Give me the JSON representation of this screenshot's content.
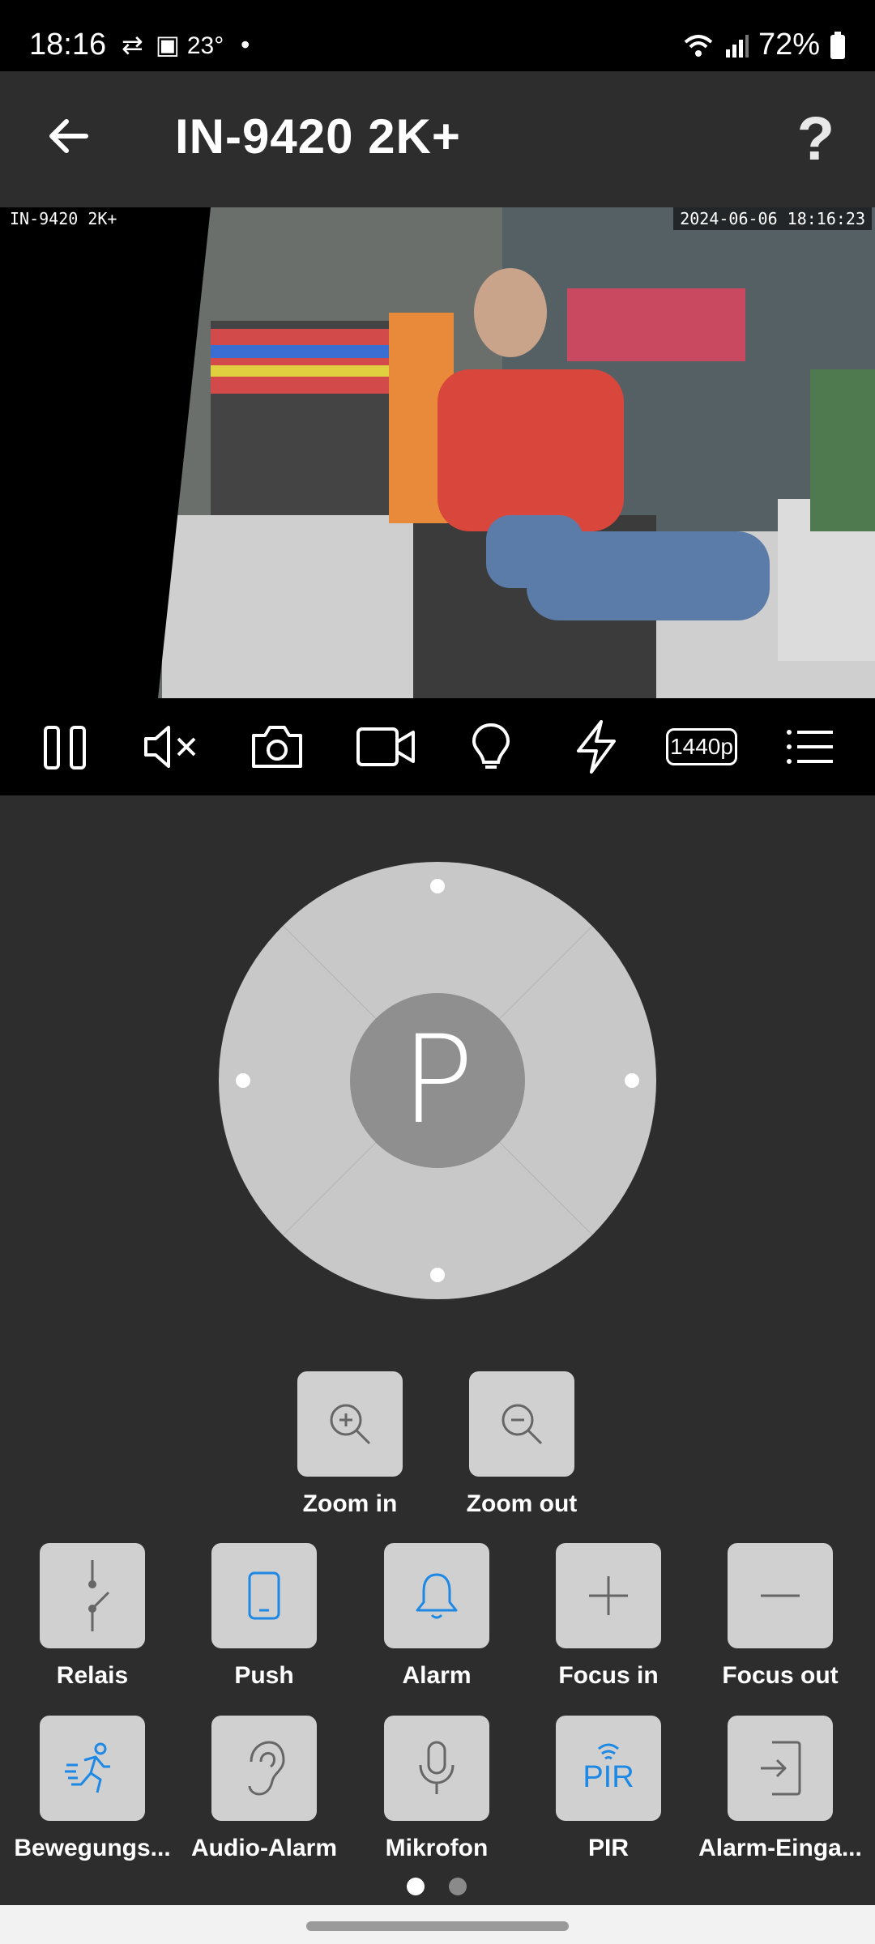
{
  "status_bar": {
    "time": "18:16",
    "temperature": "23°",
    "battery": "72%"
  },
  "header": {
    "title": "IN-9420  2K+",
    "help": "?"
  },
  "video": {
    "overlay_left": "IN-9420 2K+",
    "overlay_right": "2024-06-06 18:16:23"
  },
  "toolbar": {
    "resolution": "1440p"
  },
  "ptz": {
    "center": "P"
  },
  "zoom": {
    "in_label": "Zoom in",
    "out_label": "Zoom out"
  },
  "row1": [
    {
      "label": "Relais",
      "icon": "relay-switch-icon"
    },
    {
      "label": "Push",
      "icon": "phone-icon"
    },
    {
      "label": "Alarm",
      "icon": "bell-icon"
    },
    {
      "label": "Focus in",
      "icon": "plus-icon"
    },
    {
      "label": "Focus out",
      "icon": "minus-icon"
    }
  ],
  "row2": [
    {
      "label": "Bewegungs...",
      "icon": "motion-runner-icon"
    },
    {
      "label": "Audio-Alarm",
      "icon": "ear-icon"
    },
    {
      "label": "Mikrofon",
      "icon": "microphone-icon"
    },
    {
      "label": "PIR",
      "icon_text": "PIR"
    },
    {
      "label": "Alarm-Einga...",
      "icon": "alarm-input-icon"
    }
  ],
  "pager": {
    "pages": 2,
    "active": 1
  },
  "colors": {
    "accent": "#1e88e5",
    "button_bg": "#d0d0d0",
    "panel_bg": "#2d2d2d"
  }
}
